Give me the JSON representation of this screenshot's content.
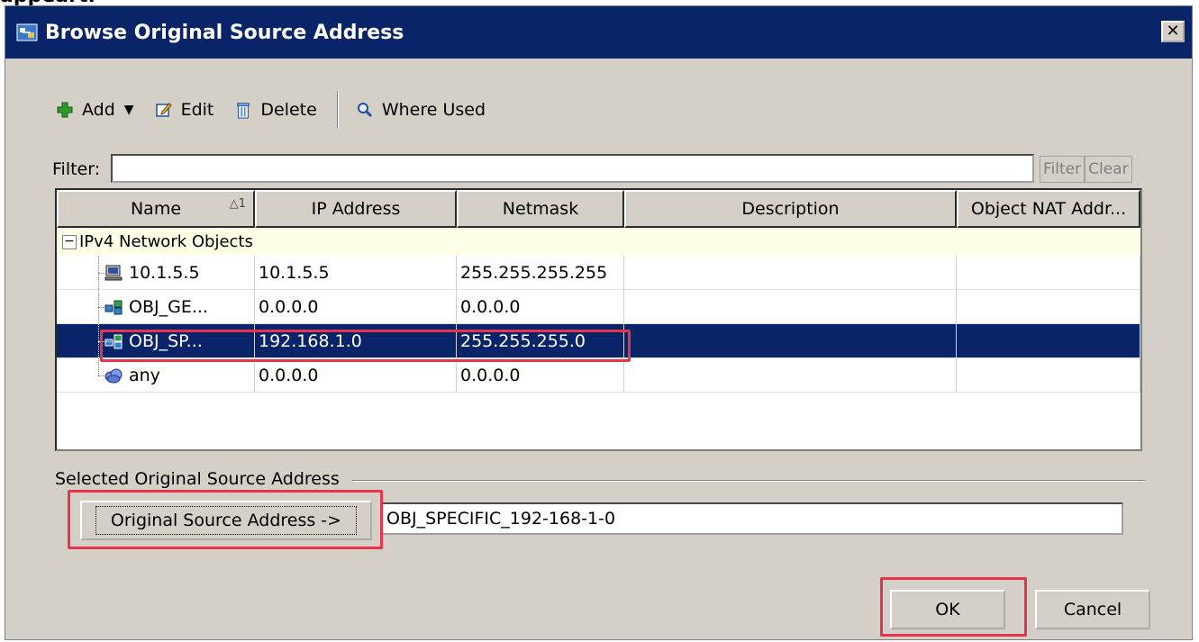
{
  "page_fragment": "appeart.",
  "window": {
    "title": "Browse Original Source Address",
    "close_label": "✕"
  },
  "toolbar": {
    "add_label": "Add",
    "edit_label": "Edit",
    "delete_label": "Delete",
    "where_used_label": "Where Used"
  },
  "filter": {
    "label": "Filter:",
    "value": "",
    "filter_button": "Filter",
    "clear_button": "Clear"
  },
  "table": {
    "columns": [
      {
        "label": "Name",
        "sort": "1"
      },
      {
        "label": "IP Address"
      },
      {
        "label": "Netmask"
      },
      {
        "label": "Description"
      },
      {
        "label": "Object NAT Addr..."
      }
    ],
    "group": {
      "expander": "−",
      "label": "IPv4 Network Objects"
    },
    "rows": [
      {
        "name": "10.1.5.5",
        "ip": "10.1.5.5",
        "netmask": "255.255.255.255",
        "description": "",
        "nat": "",
        "icon": "host-icon"
      },
      {
        "name": "OBJ_GE...",
        "ip": "0.0.0.0",
        "netmask": "0.0.0.0",
        "description": "",
        "nat": "",
        "icon": "network-icon"
      },
      {
        "name": "OBJ_SP...",
        "ip": "192.168.1.0",
        "netmask": "255.255.255.0",
        "description": "",
        "nat": "",
        "icon": "network-icon",
        "selected": true
      },
      {
        "name": "any",
        "ip": "0.0.0.0",
        "netmask": "0.0.0.0",
        "description": "",
        "nat": "",
        "icon": "cloud-icon"
      }
    ]
  },
  "selection": {
    "group_label": "Selected Original Source Address",
    "button_label": "Original Source Address ->",
    "value": "OBJ_SPECIFIC_192-168-1-0"
  },
  "footer": {
    "ok_label": "OK",
    "cancel_label": "Cancel"
  },
  "colors": {
    "titlebar": "#0a246a",
    "selection": "#0a246a",
    "highlight": "#e8334a",
    "group_row": "#ffffe6"
  }
}
